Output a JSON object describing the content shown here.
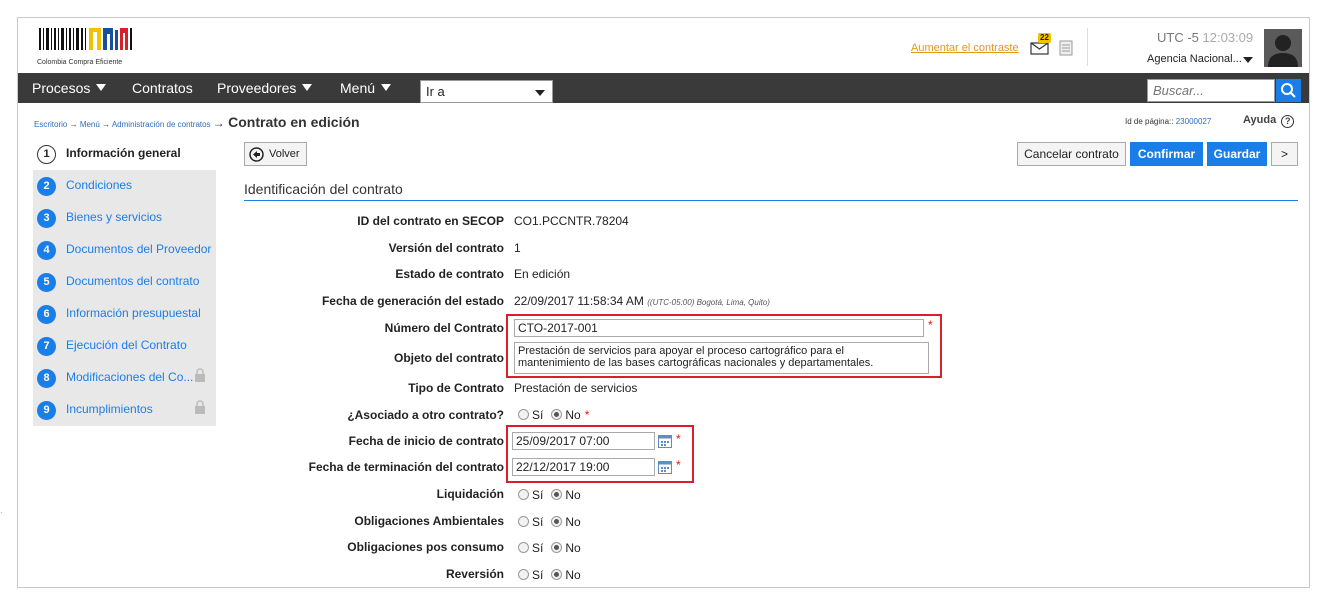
{
  "header": {
    "logo_text": "Colombia Compra Eficiente",
    "contrast_link": "Aumentar el contraste",
    "mail_badge": "22",
    "utc_label": "UTC -5",
    "utc_time": "12:03:09",
    "agency": "Agencia Nacional..."
  },
  "nav": {
    "items": [
      "Procesos",
      "Contratos",
      "Proveedores",
      "Menú"
    ],
    "goto_select": "Ir a",
    "search_placeholder": "Buscar..."
  },
  "breadcrumb": {
    "items": [
      "Escritorio",
      "Menú",
      "Administración de contratos"
    ],
    "current": "Contrato en edición",
    "page_id_label": "Id de página::",
    "page_id": "23000027",
    "help": "Ayuda",
    "help_glyph": "?"
  },
  "sidebar": {
    "steps": [
      {
        "num": "1",
        "label": "Información general",
        "active": true
      },
      {
        "num": "2",
        "label": "Condiciones"
      },
      {
        "num": "3",
        "label": "Bienes y servicios"
      },
      {
        "num": "4",
        "label": "Documentos del Proveedor"
      },
      {
        "num": "5",
        "label": "Documentos del contrato"
      },
      {
        "num": "6",
        "label": "Información presupuestal"
      },
      {
        "num": "7",
        "label": "Ejecución del Contrato"
      },
      {
        "num": "8",
        "label": "Modificaciones del Co...",
        "locked": true
      },
      {
        "num": "9",
        "label": "Incumplimientos",
        "locked": true
      }
    ]
  },
  "toolbar": {
    "back": "Volver",
    "cancel": "Cancelar contrato",
    "confirm": "Confirmar",
    "save": "Guardar",
    "more": ">"
  },
  "section": {
    "title": "Identificación del contrato"
  },
  "form": {
    "id_label": "ID del contrato en SECOP",
    "id_value": "CO1.PCCNTR.78204",
    "version_label": "Versión del contrato",
    "version_value": "1",
    "estado_label": "Estado de contrato",
    "estado_value": "En edición",
    "fecha_gen_label": "Fecha de generación del estado",
    "fecha_gen_value": "22/09/2017 11:58:34 AM",
    "fecha_gen_tz": "((UTC-05:00) Bogotá, Lima, Quito)",
    "numero_label": "Número del Contrato",
    "numero_value": "CTO-2017-001",
    "objeto_label": "Objeto del contrato",
    "objeto_line1": "Prestación de servicios para apoyar el proceso cartográfico para el",
    "objeto_line2": "mantenimiento de las bases cartográficas nacionales y departamentales.",
    "tipo_label": "Tipo de Contrato",
    "tipo_value": "Prestación de servicios",
    "asociado_label": "¿Asociado a otro contrato?",
    "inicio_label": "Fecha de inicio de contrato",
    "inicio_value": "25/09/2017 07:00",
    "termin_label": "Fecha de terminación del contrato",
    "termin_value": "22/12/2017 19:00",
    "liquidacion_label": "Liquidación",
    "ambientales_label": "Obligaciones Ambientales",
    "posconsumo_label": "Obligaciones pos consumo",
    "reversion_label": "Reversión",
    "si": "Sí",
    "no": "No",
    "req_mark": "*"
  },
  "colors": {
    "accent": "#1a7ee8",
    "navbar": "#3a3a3a",
    "highlight": "#d9202a",
    "link_orange": "#e09a12"
  }
}
